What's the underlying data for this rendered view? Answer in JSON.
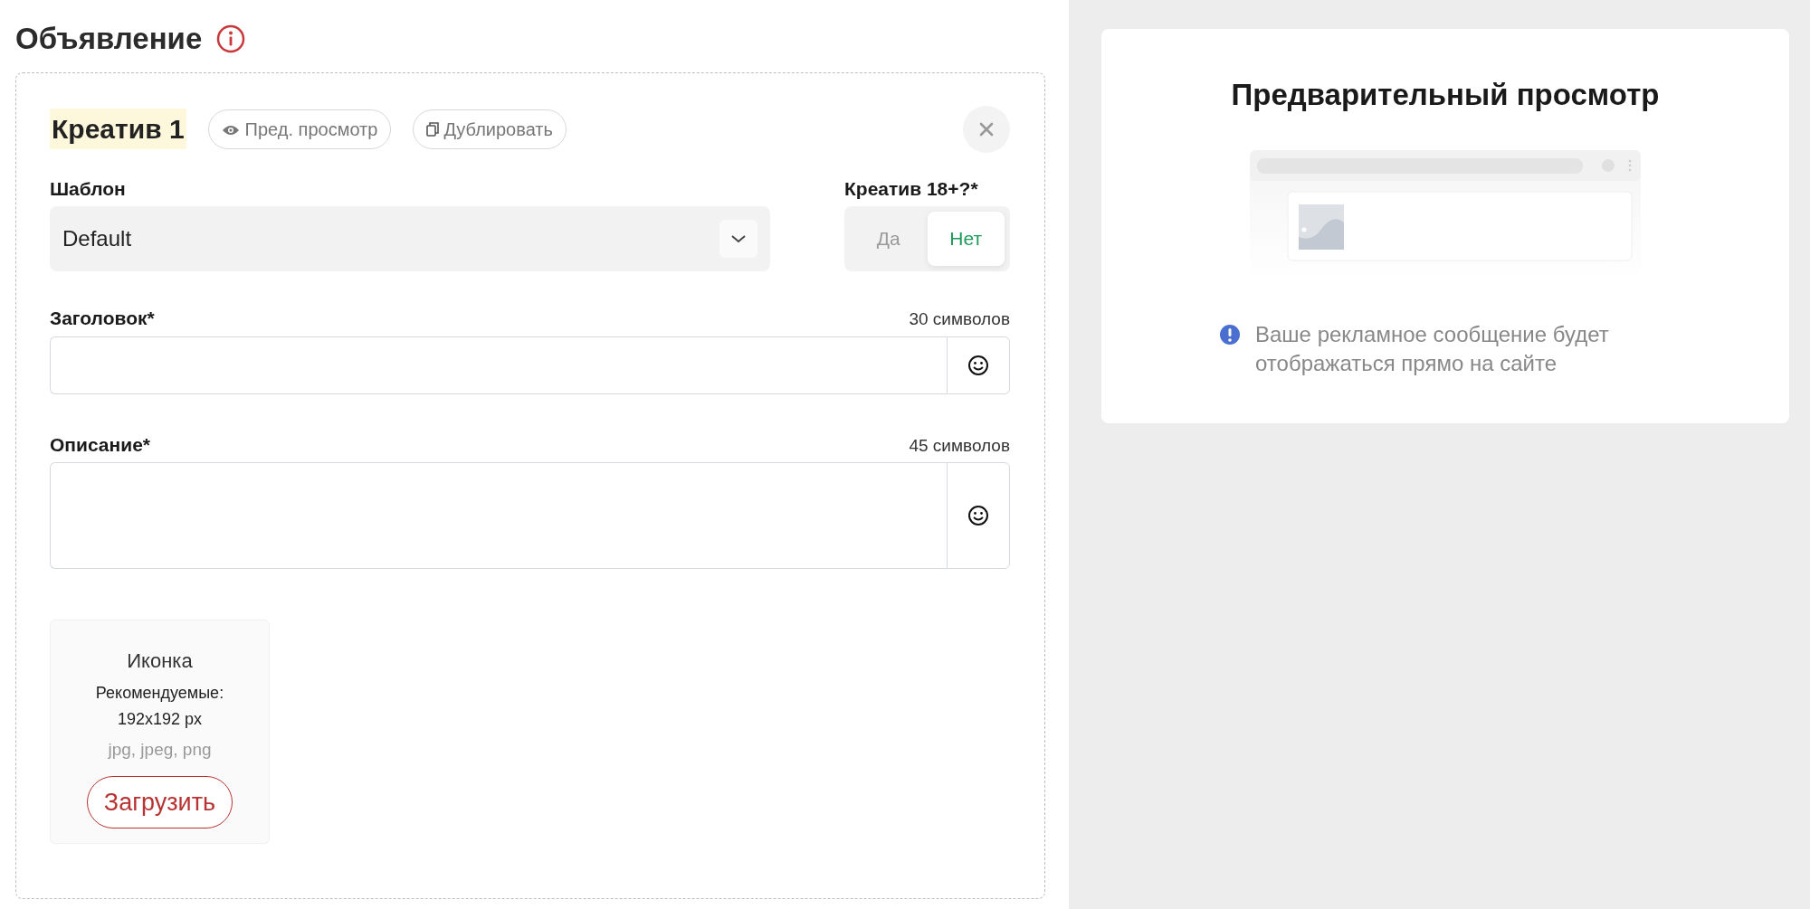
{
  "section": {
    "title": "Объявление"
  },
  "creative": {
    "title": "Креатив 1",
    "actions": [
      {
        "label": "Пред. просмотр",
        "kind": "preview"
      },
      {
        "label": "Дублировать",
        "kind": "duplicate"
      }
    ],
    "template": {
      "label": "Шаблон",
      "value": "Default"
    },
    "adult": {
      "label": "Креатив 18+?*",
      "options": [
        {
          "label": "Да",
          "selected": false
        },
        {
          "label": "Нет",
          "selected": true
        }
      ]
    },
    "fields": [
      {
        "label": "Заголовок*",
        "counter": "30 символов",
        "kind": "line"
      },
      {
        "label": "Описание*",
        "counter": "45 символов",
        "kind": "area"
      }
    ],
    "upload": {
      "title": "Иконка",
      "hint": "Рекомендуемые:",
      "size": "192x192 px",
      "formats": "jpg, jpeg, png",
      "button": "Загрузить"
    }
  },
  "preview": {
    "title": "Предварительный просмотр",
    "note": "Ваше рекламное сообщение будет отображаться прямо на сайте"
  }
}
